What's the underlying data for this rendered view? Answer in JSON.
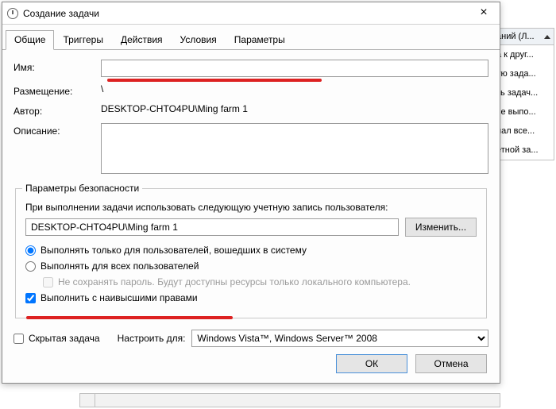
{
  "window": {
    "title": "Создание задачи"
  },
  "tabs": {
    "general": "Общие",
    "triggers": "Триггеры",
    "actions": "Действия",
    "conditions": "Условия",
    "settings": "Параметры"
  },
  "fields": {
    "name_label": "Имя:",
    "name_value": "",
    "location_label": "Размещение:",
    "location_value": "\\",
    "author_label": "Автор:",
    "author_value": "DESKTOP-CHTO4PU\\Ming farm 1",
    "description_label": "Описание:",
    "description_value": ""
  },
  "security": {
    "legend": "Параметры безопасности",
    "account_prompt": "При выполнении задачи использовать следующую учетную запись пользователя:",
    "account_value": "DESKTOP-CHTO4PU\\Ming farm 1",
    "change_btn": "Изменить...",
    "radio_logged_on": "Выполнять только для пользователей, вошедших в систему",
    "radio_any_user": "Выполнять для всех пользователей",
    "chk_nostore": "Не сохранять пароль. Будут доступны ресурсы только локального компьютера.",
    "chk_highest": "Выполнить с наивысшими правами"
  },
  "bottom": {
    "hidden_label": "Скрытая задача",
    "configure_label": "Настроить для:",
    "configure_value": "Windows Vista™, Windows Server™ 2008"
  },
  "buttons": {
    "ok": "ОК",
    "cancel": "Отмена"
  },
  "side": {
    "header": "аний (Л...",
    "items": [
      "а к друг...",
      "ую зада...",
      "ть задач...",
      "се выпо...",
      "нал все...",
      "етной за..."
    ]
  }
}
